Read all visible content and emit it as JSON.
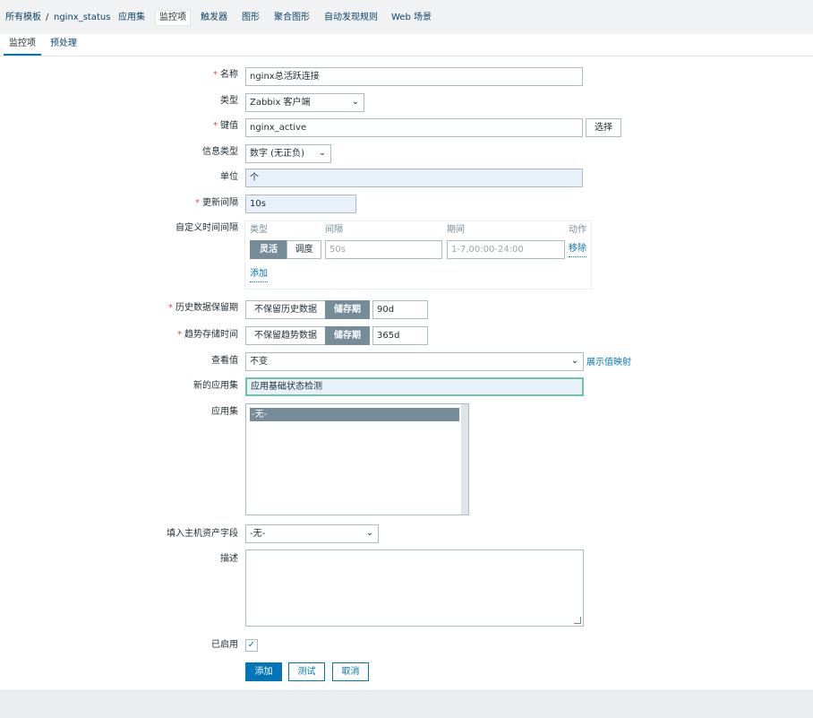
{
  "breadcrumb": {
    "all_templates": "所有模板",
    "separator": "/",
    "template": "nginx_status",
    "items": [
      "应用集",
      "监控项",
      "触发器",
      "图形",
      "聚合图形",
      "自动发现规则",
      "Web 场景"
    ]
  },
  "tabs": [
    "监控项",
    "预处理"
  ],
  "form": {
    "name": {
      "label": "名称",
      "value": "nginx总活跃连接"
    },
    "type": {
      "label": "类型",
      "value": "Zabbix 客户端"
    },
    "key": {
      "label": "键值",
      "value": "nginx_active",
      "select_label": "选择"
    },
    "info_type": {
      "label": "信息类型",
      "value": "数字 (无正负)"
    },
    "units": {
      "label": "单位",
      "value": "个"
    },
    "update_interval": {
      "label": "更新间隔",
      "value": "10s"
    },
    "custom_intervals": {
      "label": "自定义时间间隔",
      "col_type": "类型",
      "col_interval": "间隔",
      "col_period": "期间",
      "col_action": "动作",
      "row": {
        "mode_flexible": "灵活",
        "mode_scheduling": "调度",
        "interval_placeholder": "50s",
        "period_placeholder": "1-7,00:00-24:00",
        "remove": "移除"
      },
      "add": "添加"
    },
    "history": {
      "label": "历史数据保留期",
      "option_no": "不保留历史数据",
      "option_yes": "储存期",
      "value": "90d"
    },
    "trends": {
      "label": "趋势存储时间",
      "option_no": "不保留趋势数据",
      "option_yes": "储存期",
      "value": "365d"
    },
    "valuemap": {
      "label": "查看值",
      "value": "不变",
      "link": "展示值映射"
    },
    "new_application": {
      "label": "新的应用集",
      "value": "应用基础状态检测"
    },
    "applications": {
      "label": "应用集",
      "selected": "-无-"
    },
    "inventory": {
      "label": "填入主机资产字段",
      "value": "-无-"
    },
    "description": {
      "label": "描述",
      "value": ""
    },
    "enabled": {
      "label": "已启用",
      "checked": true
    }
  },
  "buttons": {
    "add": "添加",
    "test": "测试",
    "cancel": "取消"
  },
  "colors": {
    "primary": "#0275b8",
    "segment_on": "#768d99",
    "required": "#d64e4e"
  }
}
